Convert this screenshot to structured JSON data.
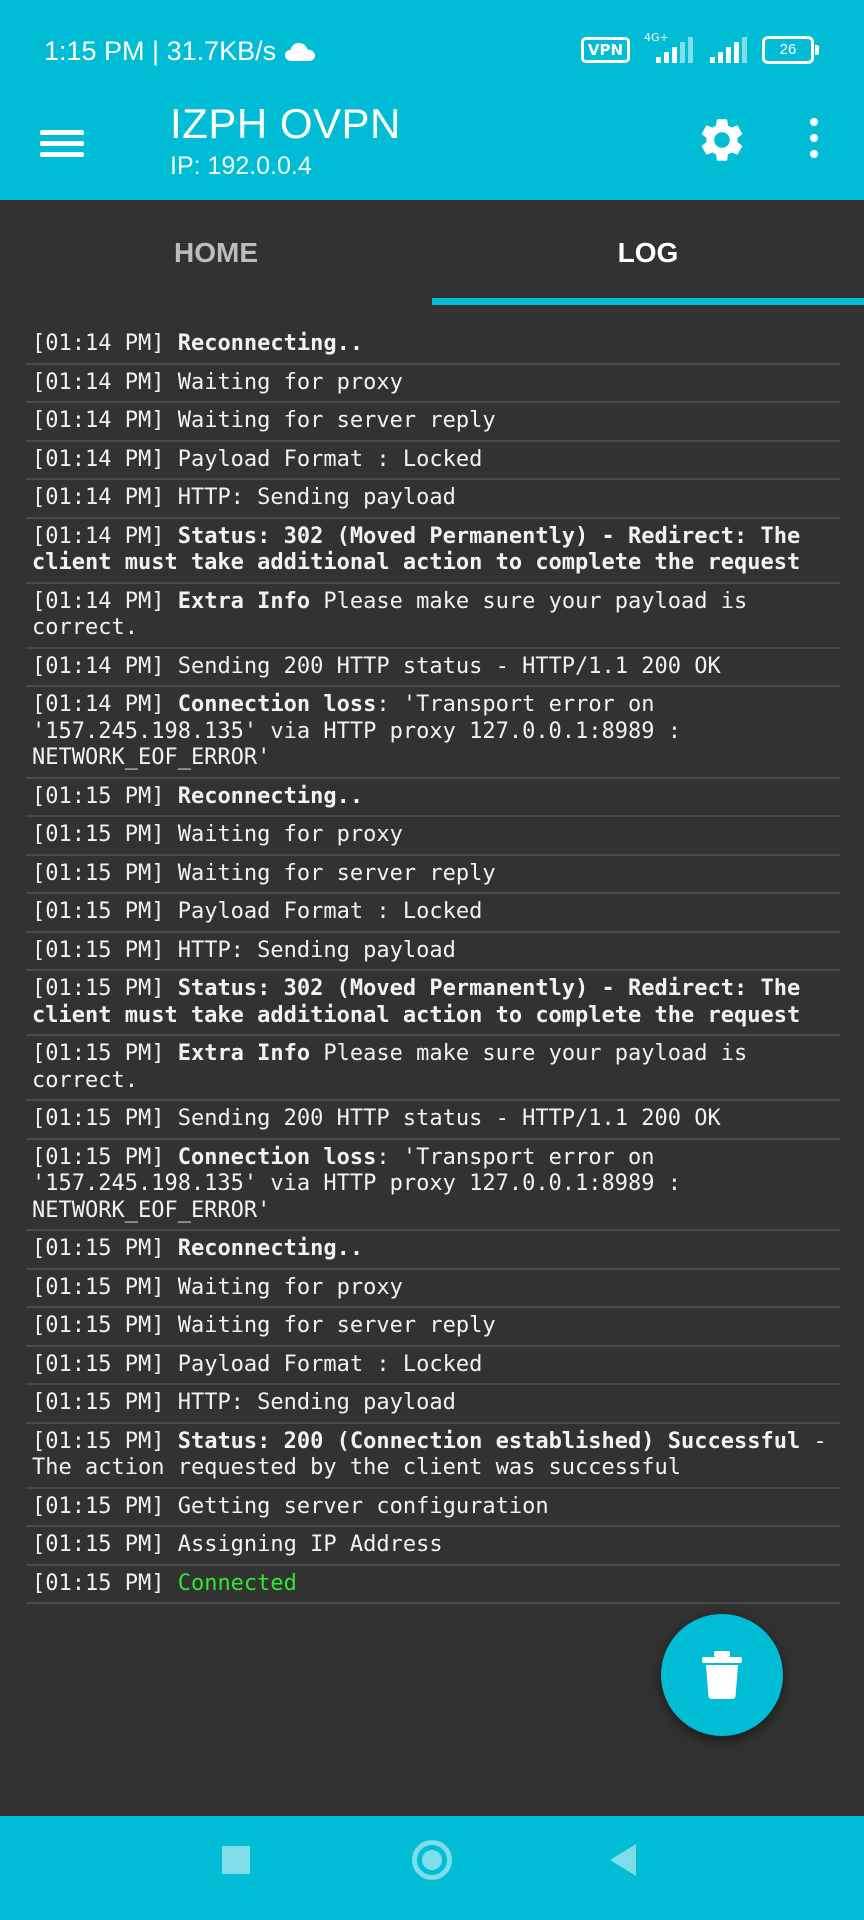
{
  "status_bar": {
    "time_speed": "1:15 PM | 31.7KB/s",
    "cloud_icon": "cloud-icon",
    "vpn": "VPN",
    "network": "4G+",
    "battery": "26"
  },
  "app_bar": {
    "title": "IZPH OVPN",
    "ip": "IP: 192.0.0.4",
    "menu_icon": "menu-icon",
    "settings_icon": "gear-icon",
    "more_icon": "more-vert-icon"
  },
  "tabs": [
    {
      "label": "HOME",
      "selected": false
    },
    {
      "label": "LOG",
      "selected": true
    }
  ],
  "log": [
    {
      "time": "[01:14 PM]",
      "bold": "Reconnecting..",
      "text": ""
    },
    {
      "time": "[01:14 PM]",
      "bold": "",
      "text": "Waiting for proxy"
    },
    {
      "time": "[01:14 PM]",
      "bold": "",
      "text": "Waiting for server reply"
    },
    {
      "time": "[01:14 PM]",
      "bold": "",
      "text": "Payload Format : Locked"
    },
    {
      "time": "[01:14 PM]",
      "bold": "",
      "text": "HTTP: Sending payload"
    },
    {
      "time": "[01:14 PM]",
      "bold": "Status: 302 (Moved Permanently) - Redirect: The client must take additional action to complete the request",
      "text": ""
    },
    {
      "time": "[01:14 PM]",
      "bold": "Extra Info",
      "text": "Please make sure your payload is correct."
    },
    {
      "time": "[01:14 PM]",
      "bold": "",
      "text": "Sending 200 HTTP status - HTTP/1.1 200 OK"
    },
    {
      "time": "[01:14 PM]",
      "bold": "Connection loss",
      "text": ": 'Transport error on '157.245.198.135' via HTTP proxy 127.0.0.1:8989 : NETWORK_EOF_ERROR'"
    },
    {
      "time": "[01:15 PM]",
      "bold": "Reconnecting..",
      "text": ""
    },
    {
      "time": "[01:15 PM]",
      "bold": "",
      "text": "Waiting for proxy"
    },
    {
      "time": "[01:15 PM]",
      "bold": "",
      "text": "Waiting for server reply"
    },
    {
      "time": "[01:15 PM]",
      "bold": "",
      "text": "Payload Format : Locked"
    },
    {
      "time": "[01:15 PM]",
      "bold": "",
      "text": "HTTP: Sending payload"
    },
    {
      "time": "[01:15 PM]",
      "bold": "Status: 302 (Moved Permanently) - Redirect: The client must take additional action to complete the request",
      "text": ""
    },
    {
      "time": "[01:15 PM]",
      "bold": "Extra Info",
      "text": "Please make sure your payload is correct."
    },
    {
      "time": "[01:15 PM]",
      "bold": "",
      "text": "Sending 200 HTTP status - HTTP/1.1 200 OK"
    },
    {
      "time": "[01:15 PM]",
      "bold": "Connection loss",
      "text": ": 'Transport error on '157.245.198.135' via HTTP proxy 127.0.0.1:8989 : NETWORK_EOF_ERROR'"
    },
    {
      "time": "[01:15 PM]",
      "bold": "Reconnecting..",
      "text": ""
    },
    {
      "time": "[01:15 PM]",
      "bold": "",
      "text": "Waiting for proxy"
    },
    {
      "time": "[01:15 PM]",
      "bold": "",
      "text": "Waiting for server reply"
    },
    {
      "time": "[01:15 PM]",
      "bold": "",
      "text": "Payload Format : Locked"
    },
    {
      "time": "[01:15 PM]",
      "bold": "",
      "text": "HTTP: Sending payload"
    },
    {
      "time": "[01:15 PM]",
      "bold": "Status: 200 (Connection established) Successful",
      "text": "- The action requested by the client was successful"
    },
    {
      "time": "[01:15 PM]",
      "bold": "",
      "text": "Getting server configuration"
    },
    {
      "time": "[01:15 PM]",
      "bold": "",
      "text": "Assigning IP Address"
    },
    {
      "time": "[01:15 PM]",
      "bold": "",
      "text": "",
      "green": "Connected"
    }
  ],
  "fab_icon": "trash-icon",
  "nav": {
    "recents_icon": "square-icon",
    "home_icon": "circle-icon",
    "back_icon": "back-triangle-icon"
  },
  "colors": {
    "accent": "#00BCD4",
    "background": "#323232",
    "log_text": "#f2f2f2",
    "connected_green": "#32e632"
  }
}
